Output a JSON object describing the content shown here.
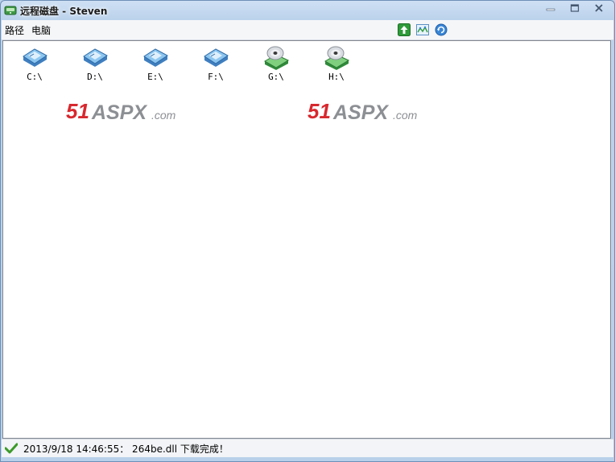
{
  "window": {
    "title": "远程磁盘  - Steven",
    "icon": "network-drive-icon"
  },
  "menu": {
    "items": [
      {
        "label": "路径"
      },
      {
        "label": "电脑"
      }
    ]
  },
  "toolbar": {
    "buttons": [
      {
        "icon": "up-arrow-icon"
      },
      {
        "icon": "network-icon"
      },
      {
        "icon": "refresh-icon"
      }
    ]
  },
  "drives": [
    {
      "label": "C:\\",
      "type": "hard-disk"
    },
    {
      "label": "D:\\",
      "type": "hard-disk"
    },
    {
      "label": "E:\\",
      "type": "hard-disk"
    },
    {
      "label": "F:\\",
      "type": "hard-disk"
    },
    {
      "label": "G:\\",
      "type": "cd-drive"
    },
    {
      "label": "H:\\",
      "type": "cd-drive"
    }
  ],
  "watermarks": [
    {
      "text": "51ASPX.com"
    },
    {
      "text": "51ASPX.com"
    }
  ],
  "status": {
    "icon": "checkmark-icon",
    "text": "2013/9/18 14:46:55： 264be.dll 下载完成！"
  },
  "colors": {
    "accent": "#2f7fd6",
    "watermark_red": "#d8282e",
    "watermark_gray": "#8c8f93",
    "status_green": "#3c9a2a"
  }
}
